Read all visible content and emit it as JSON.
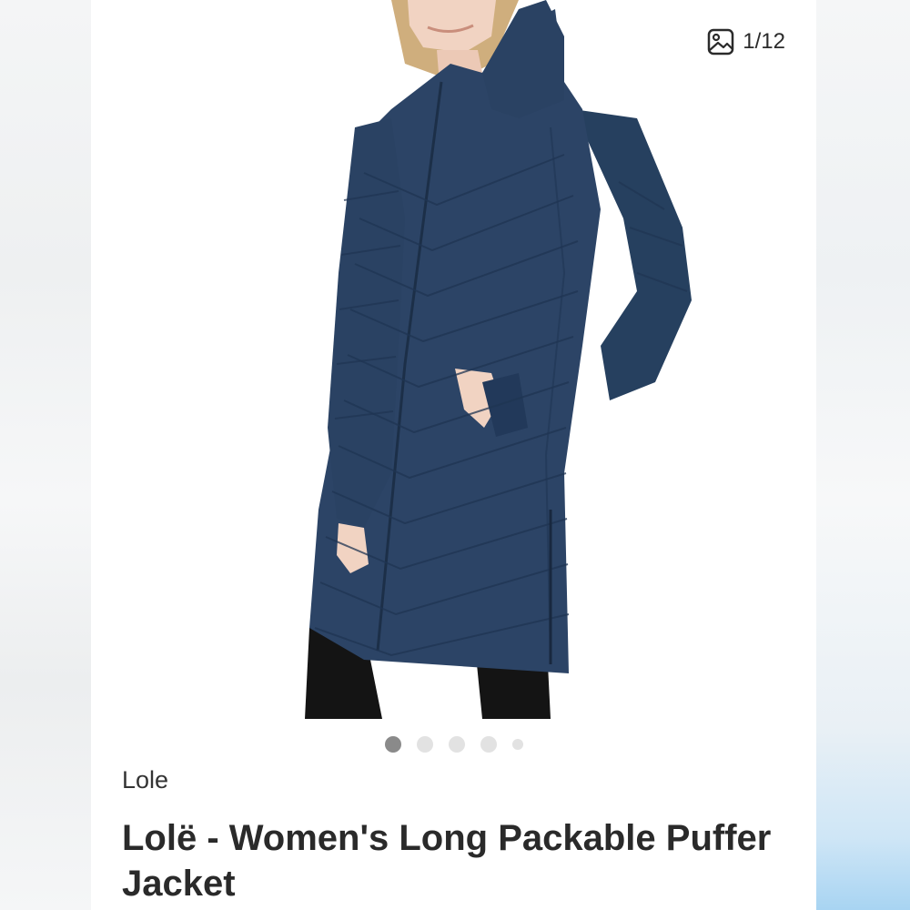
{
  "gallery": {
    "counter_text": "1/12",
    "counter_icon": "image-gallery-icon",
    "total_dots": 5,
    "active_dot": 1
  },
  "product": {
    "brand": "Lole",
    "title": "Lolë - Women's Long Packable Puffer Jacket",
    "jacket_color": "#2c4466"
  }
}
